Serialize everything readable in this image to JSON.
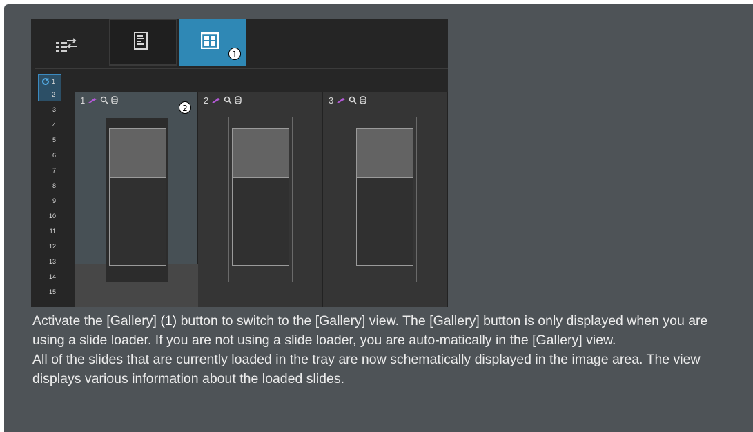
{
  "toolbar": {
    "swap_icon": "transfer-list-icon",
    "list_icon": "list-view-icon",
    "gallery_icon": "gallery-grid-icon",
    "callout_1": "1",
    "callout_2": "2"
  },
  "slots": [
    "1",
    "2",
    "3",
    "4",
    "5",
    "6",
    "7",
    "8",
    "9",
    "10",
    "11",
    "12",
    "13",
    "14",
    "15"
  ],
  "gallery": {
    "cards": [
      {
        "number": "1"
      },
      {
        "number": "2"
      },
      {
        "number": "3"
      }
    ]
  },
  "description": {
    "line1_a": "Activate the [Gallery] ",
    "line1_b": "(1)",
    "line1_c": " button to switch to the [Gallery] view. The [Gallery] button is only displayed when you are using a slide loader. If you are not using a slide loader, you are auto-matically in the [Gallery] view.",
    "line2": "All of the slides that are currently loaded in the tray are now schematically displayed in the image area. The view displays various information about the loaded slides."
  },
  "colors": {
    "panel": "#4e5357",
    "gallery_active": "#2f88b5"
  }
}
